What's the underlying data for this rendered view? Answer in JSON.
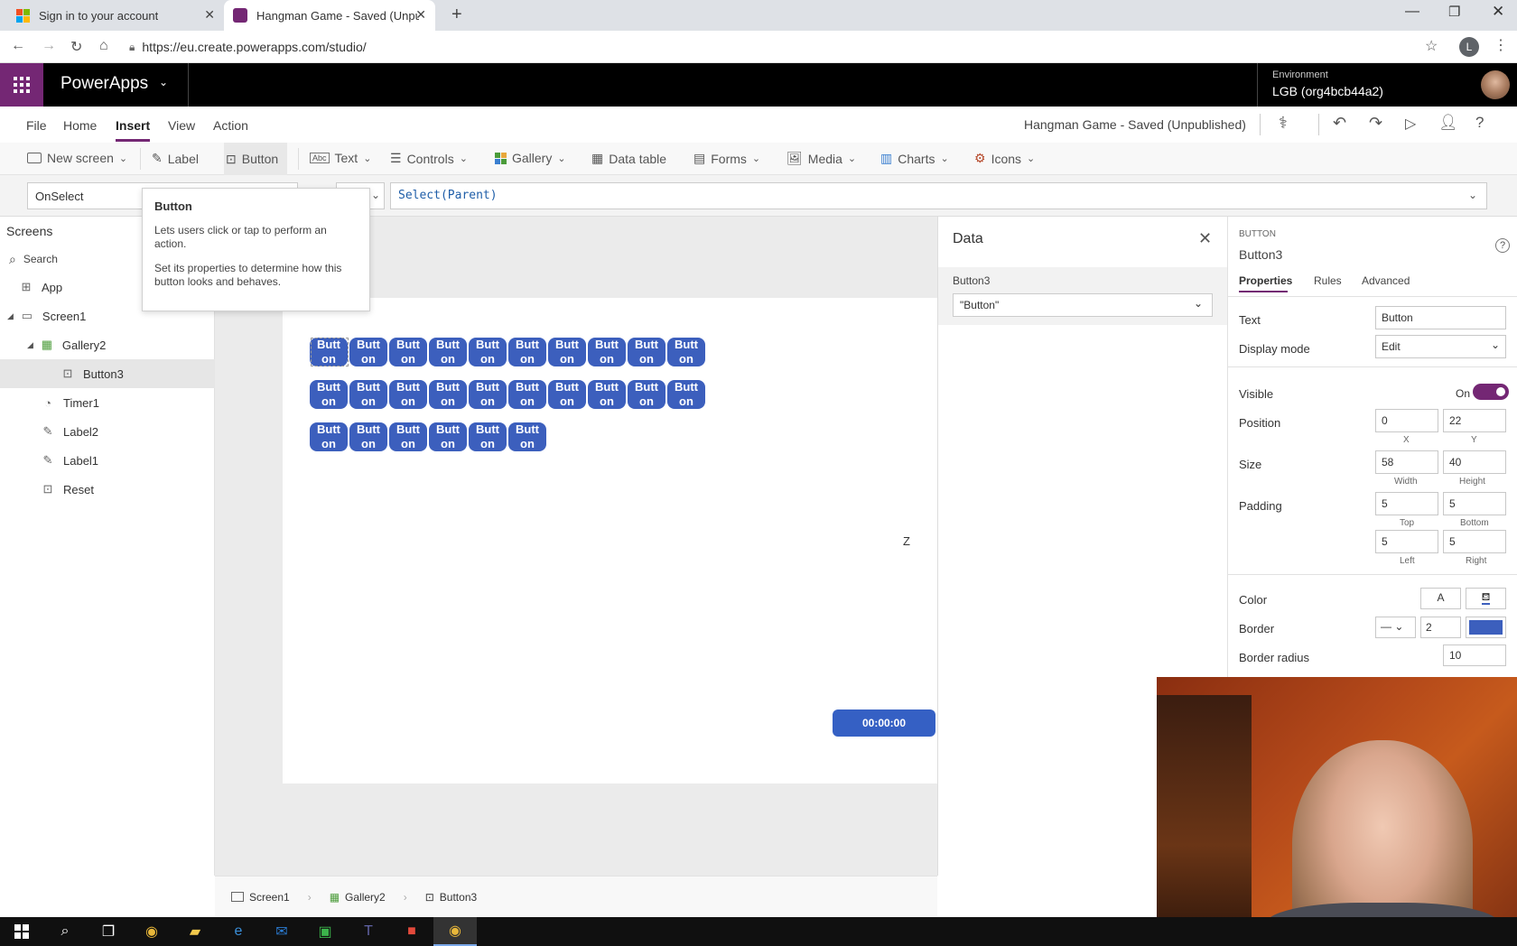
{
  "browser": {
    "tabs": [
      {
        "title": "Sign in to your account"
      },
      {
        "title": "Hangman Game - Saved (Unpubl"
      }
    ],
    "url": "https://eu.create.powerapps.com/studio/",
    "profile_initial": "L"
  },
  "header": {
    "app_name": "PowerApps",
    "env_label": "Environment",
    "env_name": "LGB (org4bcb44a2)"
  },
  "menu": {
    "items": [
      "File",
      "Home",
      "Insert",
      "View",
      "Action"
    ],
    "active": "Insert",
    "doc_title": "Hangman Game - Saved (Unpublished)"
  },
  "ribbon": {
    "new_screen": "New screen",
    "label": "Label",
    "button": "Button",
    "text": "Text",
    "controls": "Controls",
    "gallery": "Gallery",
    "data_table": "Data table",
    "forms": "Forms",
    "media": "Media",
    "charts": "Charts",
    "icons": "Icons"
  },
  "formula": {
    "property": "OnSelect",
    "expression": "Select(Parent)"
  },
  "tooltip": {
    "title": "Button",
    "line1": "Lets users click or tap to perform an action.",
    "line2": "Set its properties to determine how this button looks and behaves."
  },
  "tree": {
    "header": "Screens",
    "search_placeholder": "Search",
    "items": [
      {
        "label": "App"
      },
      {
        "label": "Screen1"
      },
      {
        "label": "Gallery2"
      },
      {
        "label": "Button3"
      },
      {
        "label": "Timer1"
      },
      {
        "label": "Label2"
      },
      {
        "label": "Label1"
      },
      {
        "label": "Reset"
      }
    ]
  },
  "canvas": {
    "gallery_button_text_line1": "Butt",
    "gallery_button_text_line2": "on",
    "button_count": 26,
    "letter_label": "Z",
    "timer_text": "00:00:00"
  },
  "data_pane": {
    "title": "Data",
    "field_label": "Button3",
    "field_value": "\"Button\""
  },
  "props": {
    "type": "BUTTON",
    "name": "Button3",
    "tabs": [
      "Properties",
      "Rules",
      "Advanced"
    ],
    "text_label": "Text",
    "text_value": "Button",
    "display_mode_label": "Display mode",
    "display_mode_value": "Edit",
    "visible_label": "Visible",
    "visible_value": "On",
    "position_label": "Position",
    "pos_x": "0",
    "pos_y": "22",
    "x_label": "X",
    "y_label": "Y",
    "size_label": "Size",
    "width": "58",
    "height": "40",
    "width_label": "Width",
    "height_label": "Height",
    "padding_label": "Padding",
    "pad_top": "5",
    "pad_bottom": "5",
    "pad_left": "5",
    "pad_right": "5",
    "top_label": "Top",
    "bottom_label": "Bottom",
    "left_label": "Left",
    "right_label": "Right",
    "color_label": "Color",
    "color_a": "A",
    "border_label": "Border",
    "border_width": "2",
    "border_radius_label": "Border radius",
    "border_radius": "10"
  },
  "breadcrumb": [
    "Screen1",
    "Gallery2",
    "Button3"
  ],
  "colors": {
    "brand": "#742774",
    "button_fill": "#3c5fbd",
    "toggle_on": "#742774"
  }
}
